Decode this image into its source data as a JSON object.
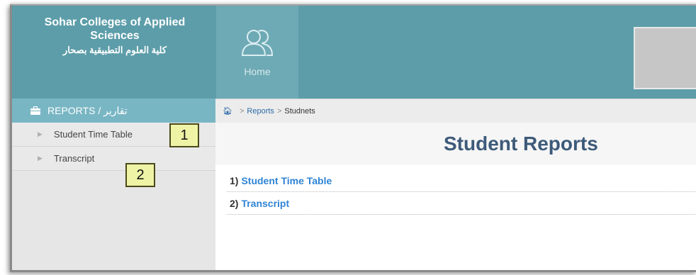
{
  "header": {
    "brand_en": "Sohar Colleges of Applied Sciences",
    "brand_ar": "كلية العلوم التطبيقية بصحار",
    "home_label": "Home",
    "home_icon": "users-icon"
  },
  "sidebar": {
    "section_label": "REPORTS / تقارير",
    "section_icon": "briefcase-icon",
    "items": [
      {
        "label": "Student Time Table"
      },
      {
        "label": "Transcript"
      }
    ]
  },
  "breadcrumb": {
    "home_icon": "home-icon",
    "items": [
      "Reports",
      "Studnets"
    ]
  },
  "main": {
    "title": "Student Reports",
    "reports": [
      {
        "number": "1)",
        "label": "Student Time Table"
      },
      {
        "number": "2)",
        "label": "Transcript"
      }
    ]
  },
  "annotations": [
    "1",
    "2"
  ],
  "colors": {
    "header": "#5c9da9",
    "sidebar_head": "#79b6c4",
    "link": "#2f84d6",
    "title": "#3d5a7a"
  }
}
